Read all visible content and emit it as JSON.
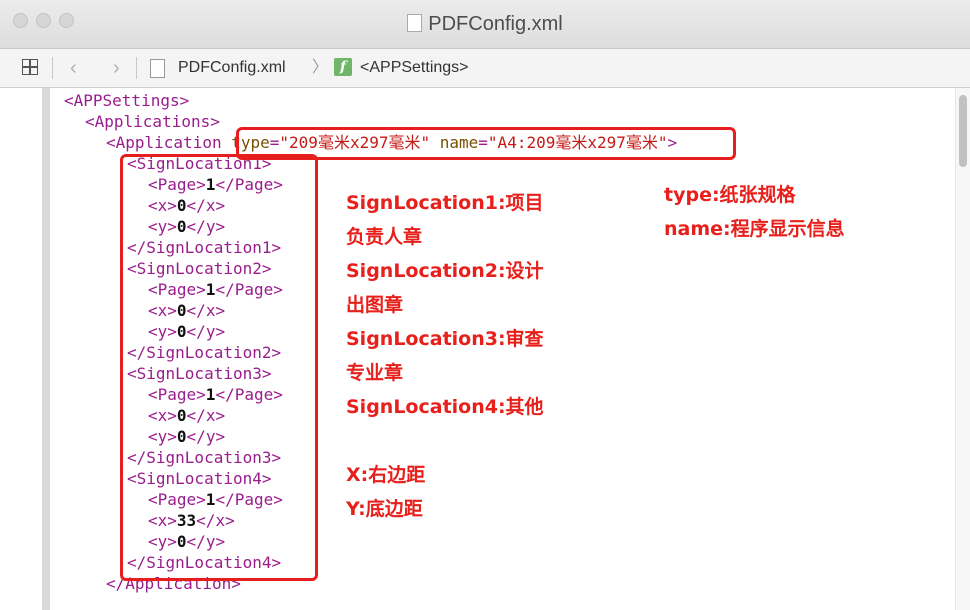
{
  "window": {
    "title": "PDFConfig.xml",
    "controls": [
      "close",
      "minimize",
      "zoom"
    ]
  },
  "pathbar": {
    "back_icon": "chevron-left",
    "forward_icon": "chevron-right",
    "file": "PDFConfig.xml",
    "path_separator": "〉",
    "element": "<APPSettings>",
    "element_icon_letter": "f"
  },
  "code_lines": [
    {
      "indent": 0,
      "text": "<APPSettings>"
    },
    {
      "indent": 1,
      "text": "<Applications>"
    },
    {
      "indent": 2,
      "text": "<Application type=\"209毫米x297毫米\" name=\"A4:209毫米x297毫米\">"
    },
    {
      "indent": 3,
      "text": "<SignLocation1>"
    },
    {
      "indent": 4,
      "text": "<Page>1</Page>"
    },
    {
      "indent": 4,
      "text": "<x>0</x>"
    },
    {
      "indent": 4,
      "text": "<y>0</y>"
    },
    {
      "indent": 3,
      "text": "</SignLocation1>"
    },
    {
      "indent": 3,
      "text": "<SignLocation2>"
    },
    {
      "indent": 4,
      "text": "<Page>1</Page>"
    },
    {
      "indent": 4,
      "text": "<x>0</x>"
    },
    {
      "indent": 4,
      "text": "<y>0</y>"
    },
    {
      "indent": 3,
      "text": "</SignLocation2>"
    },
    {
      "indent": 3,
      "text": "<SignLocation3>"
    },
    {
      "indent": 4,
      "text": "<Page>1</Page>"
    },
    {
      "indent": 4,
      "text": "<x>0</x>"
    },
    {
      "indent": 4,
      "text": "<y>0</y>"
    },
    {
      "indent": 3,
      "text": "</SignLocation3>"
    },
    {
      "indent": 3,
      "text": "<SignLocation4>"
    },
    {
      "indent": 4,
      "text": "<Page>1</Page>"
    },
    {
      "indent": 4,
      "text": "<x>33</x>"
    },
    {
      "indent": 4,
      "text": "<y>0</y>"
    },
    {
      "indent": 3,
      "text": "</SignLocation4>"
    },
    {
      "indent": 2,
      "text": "</Application>"
    }
  ],
  "annotations": {
    "left": [
      "SignLocation1:项目",
      "负责人章",
      "SignLocation2:设计",
      "出图章",
      "SignLocation3:审查",
      "专业章",
      "SignLocation4:其他",
      "",
      "X:右边距",
      "Y:底边距"
    ],
    "right": [
      "type:纸张规格",
      "name:程序显示信息"
    ]
  },
  "colors": {
    "tag": "#9a1d8c",
    "value": "#111111",
    "attr": "#7a4f00",
    "string": "#c41a16",
    "annotation": "#e8201c",
    "highlight_box": "#e61e1e"
  }
}
